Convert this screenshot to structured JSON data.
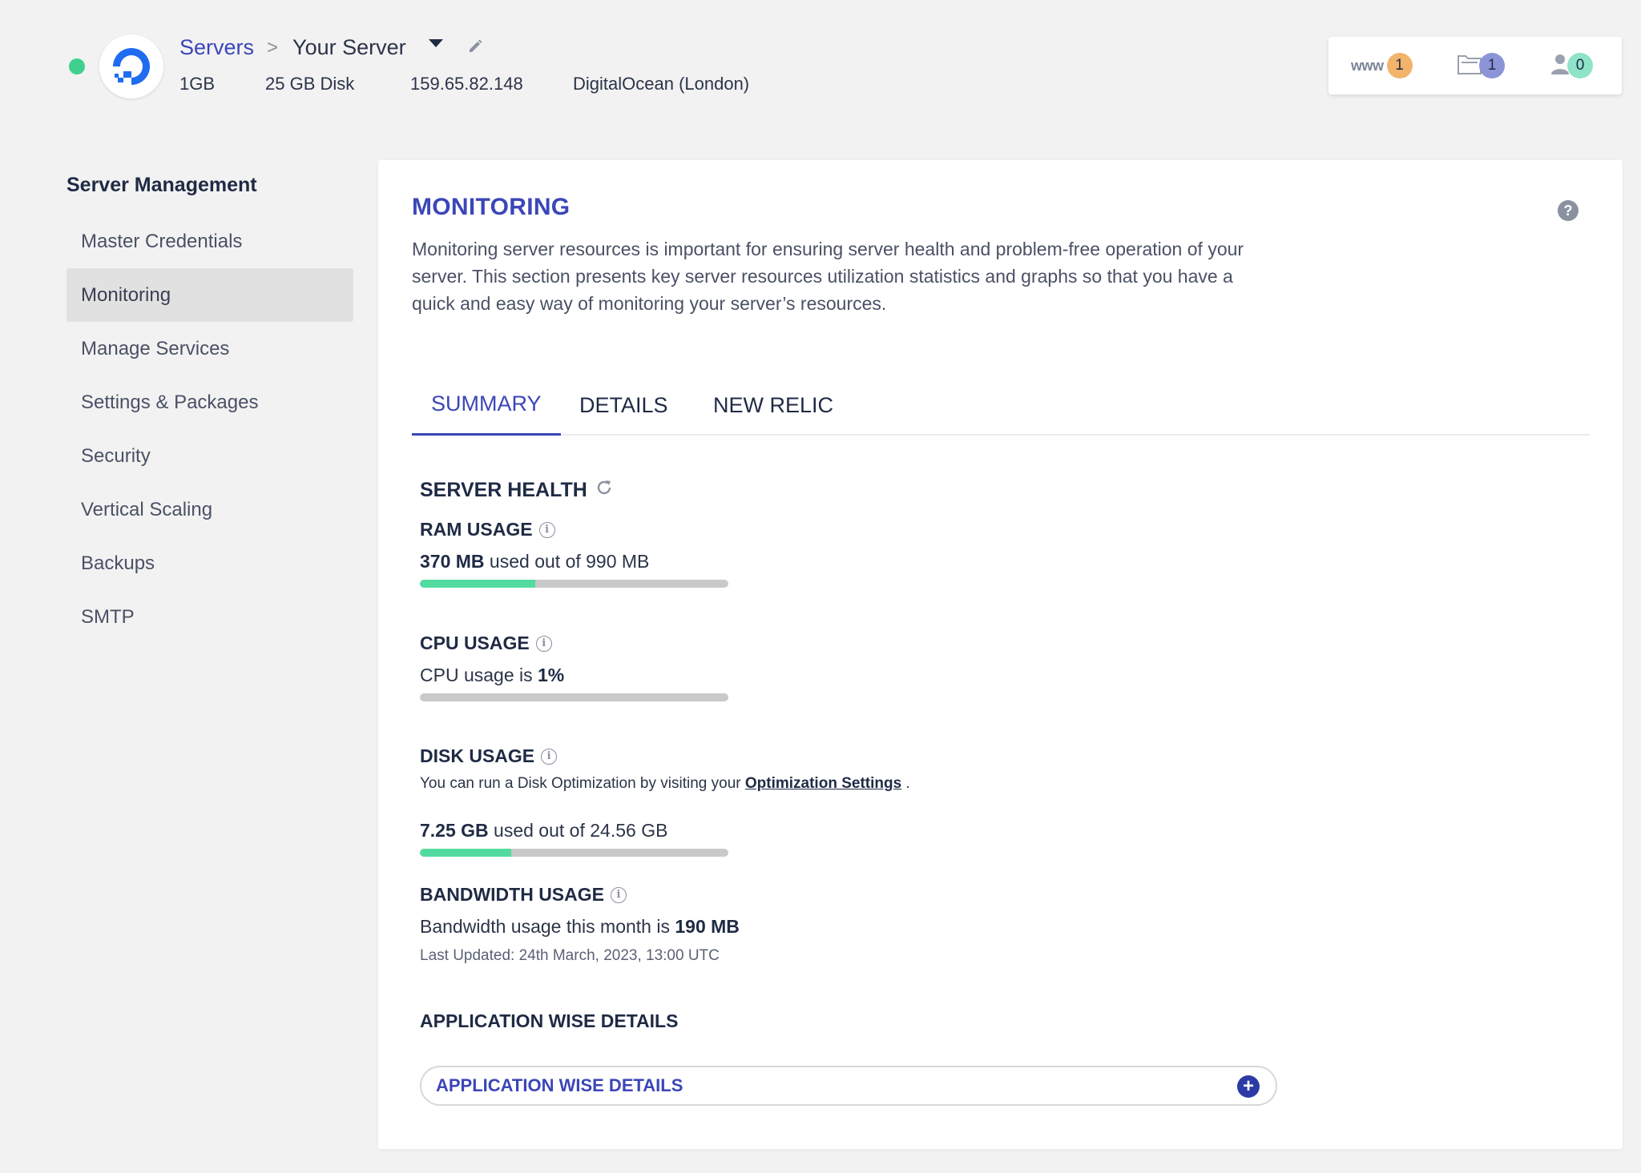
{
  "header": {
    "breadcrumb_parent": "Servers",
    "breadcrumb_separator": ">",
    "server_name": "Your Server",
    "server_status_color": "#3fd08f",
    "meta": {
      "size": "1GB",
      "disk": "25 GB Disk",
      "ip": "159.65.82.148",
      "provider": "DigitalOcean (London)"
    },
    "counters": {
      "www_label": "www",
      "www_count": "1",
      "files_count": "1",
      "users_count": "0"
    }
  },
  "sidebar": {
    "title": "Server Management",
    "items": [
      {
        "label": "Master Credentials"
      },
      {
        "label": "Monitoring",
        "active": true
      },
      {
        "label": "Manage Services"
      },
      {
        "label": "Settings & Packages"
      },
      {
        "label": "Security"
      },
      {
        "label": "Vertical Scaling"
      },
      {
        "label": "Backups"
      },
      {
        "label": "SMTP"
      }
    ]
  },
  "main": {
    "title": "MONITORING",
    "help": "?",
    "description": "Monitoring server resources is important for ensuring server health and problem-free operation of your server. This section presents key server resources utilization statistics and graphs so that you have a quick and easy way of monitoring your server’s resources.",
    "tabs": [
      {
        "label": "SUMMARY",
        "active": true
      },
      {
        "label": "DETAILS"
      },
      {
        "label": "NEW RELIC"
      }
    ],
    "server_health": {
      "title": "SERVER HEALTH",
      "ram": {
        "title": "RAM USAGE",
        "used": "370 MB",
        "suffix": " used out of 990 MB",
        "fraction": 0.374
      },
      "cpu": {
        "title": "CPU USAGE",
        "prefix": "CPU usage is ",
        "value": "1%",
        "fraction": 0.0
      },
      "disk": {
        "title": "DISK USAGE",
        "note_prefix": "You can run a Disk Optimization by visiting your ",
        "note_link": "Optimization Settings",
        "note_suffix": " .",
        "used": "7.25 GB",
        "suffix": " used out of 24.56 GB",
        "fraction": 0.295
      },
      "bandwidth": {
        "title": "BANDWIDTH USAGE",
        "prefix": "Bandwidth usage this month is ",
        "value": "190 MB",
        "last_updated": "Last Updated: 24th March, 2023, 13:00 UTC"
      }
    },
    "app_details": {
      "title": "APPLICATION WISE DETAILS",
      "accordion_label": "APPLICATION WISE DETAILS"
    }
  },
  "colors": {
    "accent": "#3b46b8",
    "bar_fill": "#52dba0",
    "bar_track": "#c9c9c9",
    "badge_www": "#f2b36b",
    "badge_files": "#8c94d8",
    "badge_users": "#8ee3c8"
  }
}
